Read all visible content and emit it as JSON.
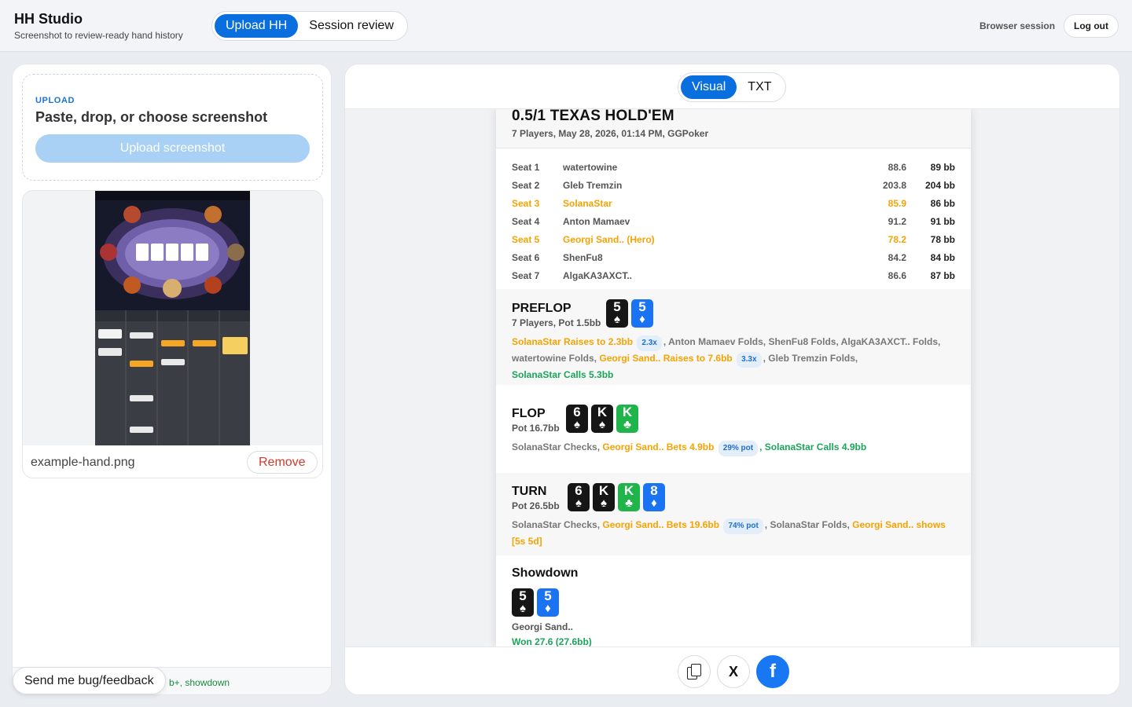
{
  "app": {
    "title": "HH Studio",
    "subtitle": "Screenshot to review-ready hand history"
  },
  "nav": {
    "tabs": [
      {
        "label": "Upload HH",
        "active": true
      },
      {
        "label": "Session review",
        "active": false
      }
    ]
  },
  "header": {
    "session": "Browser session",
    "logout": "Log out"
  },
  "upload": {
    "tag": "UPLOAD",
    "title": "Paste, drop, or choose screenshot",
    "button": "Upload screenshot"
  },
  "file": {
    "name": "example-hand.png",
    "remove": "Remove"
  },
  "status": {
    "text": "b+, showdown"
  },
  "feedback": {
    "label": "Send me bug/feedback"
  },
  "view_toggle": {
    "options": [
      {
        "label": "Visual",
        "active": true
      },
      {
        "label": "TXT",
        "active": false
      }
    ]
  },
  "hand": {
    "title": "0.5/1 TEXAS HOLD'EM",
    "subtitle": "7 Players, May 28, 2026, 01:14 PM, GGPoker",
    "seats": [
      {
        "seat": "Seat 1",
        "name": "watertowine",
        "stack": "88.6",
        "bb": "89 bb",
        "highlight": false
      },
      {
        "seat": "Seat 2",
        "name": "Gleb Tremzin",
        "stack": "203.8",
        "bb": "204 bb",
        "highlight": false
      },
      {
        "seat": "Seat 3",
        "name": "SolanaStar",
        "stack": "85.9",
        "bb": "86 bb",
        "highlight": true
      },
      {
        "seat": "Seat 4",
        "name": "Anton Mamaev",
        "stack": "91.2",
        "bb": "91 bb",
        "highlight": false
      },
      {
        "seat": "Seat 5",
        "name": "Georgi Sand.. (Hero)",
        "stack": "78.2",
        "bb": "78 bb",
        "highlight": true
      },
      {
        "seat": "Seat 6",
        "name": "ShenFu8",
        "stack": "84.2",
        "bb": "84 bb",
        "highlight": false
      },
      {
        "seat": "Seat 7",
        "name": "AlgaKA3AXCT..",
        "stack": "86.6",
        "bb": "87 bb",
        "highlight": false
      }
    ],
    "preflop": {
      "title": "PREFLOP",
      "sub": "7 Players, Pot 1.5bb",
      "cards": [
        {
          "rank": "5",
          "suit": "♠",
          "color": "black"
        },
        {
          "rank": "5",
          "suit": "♦",
          "color": "blue"
        }
      ],
      "a1": "SolanaStar Raises to 2.3bb",
      "c1": "2.3x",
      "a2": ", Anton Mamaev Folds, ShenFu8 Folds, AlgaKA3AXCT.. Folds, watertowine Folds, ",
      "a3": "Georgi Sand.. Raises to 7.6bb",
      "c2": "3.3x",
      "a4": ", Gleb Tremzin Folds,",
      "a5": "SolanaStar Calls 5.3bb"
    },
    "flop": {
      "title": "FLOP",
      "sub": "Pot 16.7bb",
      "cards": [
        {
          "rank": "6",
          "suit": "♠",
          "color": "black"
        },
        {
          "rank": "K",
          "suit": "♠",
          "color": "black"
        },
        {
          "rank": "K",
          "suit": "♣",
          "color": "green"
        }
      ],
      "a1": "SolanaStar Checks, ",
      "a2": "Georgi Sand.. Bets 4.9bb",
      "c1": "29% pot",
      "a3": ", SolanaStar Calls 4.9bb"
    },
    "turn": {
      "title": "TURN",
      "sub": "Pot 26.5bb",
      "cards": [
        {
          "rank": "6",
          "suit": "♠",
          "color": "black"
        },
        {
          "rank": "K",
          "suit": "♠",
          "color": "black"
        },
        {
          "rank": "K",
          "suit": "♣",
          "color": "green"
        },
        {
          "rank": "8",
          "suit": "♦",
          "color": "blue"
        }
      ],
      "a1": "SolanaStar Checks, ",
      "a2": "Georgi Sand.. Bets 19.6bb",
      "c1": "74% pot",
      "a3": ", SolanaStar Folds, ",
      "a4": "Georgi Sand.. shows [5s 5d]"
    },
    "showdown": {
      "title": "Showdown",
      "cards": [
        {
          "rank": "5",
          "suit": "♠",
          "color": "black"
        },
        {
          "rank": "5",
          "suit": "♦",
          "color": "blue"
        }
      ],
      "player": "Georgi Sand..",
      "result": "Won 27.6 (27.6bb)"
    }
  },
  "share": {
    "x": "X",
    "facebook": "f"
  },
  "colors": {
    "accent": "#0a6fde",
    "hero": "#f5a300",
    "win": "#19a65a"
  }
}
